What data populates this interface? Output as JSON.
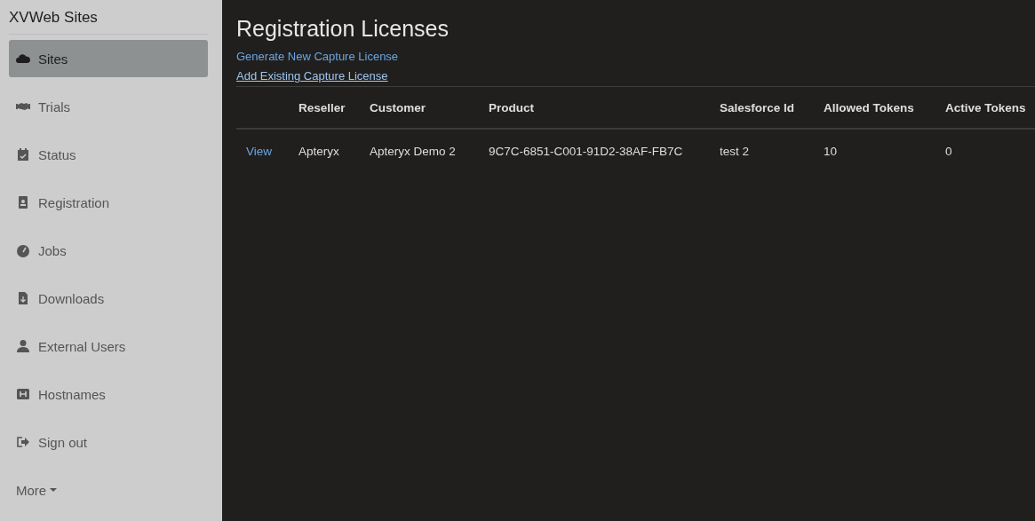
{
  "sidebar": {
    "brand": "XVWeb Sites",
    "items": [
      {
        "label": "Sites",
        "selected": true
      },
      {
        "label": "Trials",
        "selected": false
      },
      {
        "label": "Status",
        "selected": false
      },
      {
        "label": "Registration",
        "selected": false
      },
      {
        "label": "Jobs",
        "selected": false
      },
      {
        "label": "Downloads",
        "selected": false
      },
      {
        "label": "External Users",
        "selected": false
      },
      {
        "label": "Hostnames",
        "selected": false
      },
      {
        "label": "Sign out",
        "selected": false
      }
    ],
    "more": "More"
  },
  "main": {
    "title": "Registration Licenses",
    "links": [
      "Generate New Capture License",
      "Add Existing Capture License"
    ],
    "table": {
      "columns": [
        "Reseller",
        "Customer",
        "Product",
        "Salesforce Id",
        "Allowed Tokens",
        "Active Tokens"
      ],
      "rows": [
        {
          "action": "View",
          "cells": [
            "Apteryx",
            "Apteryx Demo 2",
            "9C7C-6851-C001-91D2-38AF-FB7C",
            "test 2",
            "10",
            "0"
          ]
        }
      ]
    }
  }
}
